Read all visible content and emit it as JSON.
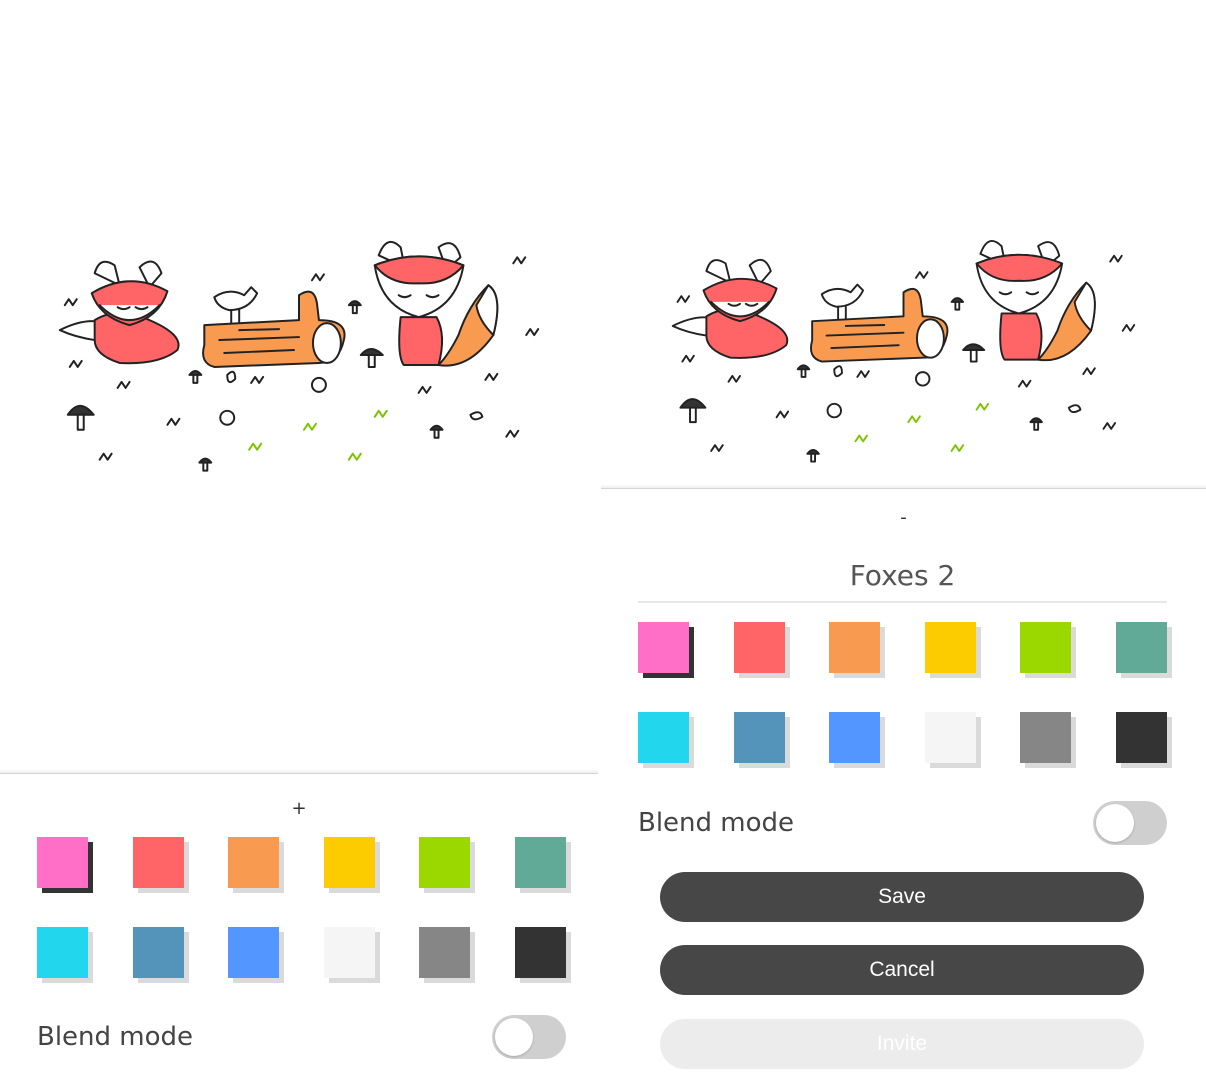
{
  "left_panel": {
    "handle": "+",
    "swatches": [
      {
        "color": "#ff6fc8",
        "selected": true
      },
      {
        "color": "#ff6466"
      },
      {
        "color": "#f89b50"
      },
      {
        "color": "#fccc00"
      },
      {
        "color": "#9ad800"
      },
      {
        "color": "#62aa98"
      },
      {
        "color": "#22d6ee"
      },
      {
        "color": "#5594ba"
      },
      {
        "color": "#5496ff"
      },
      {
        "color": "#f5f5f5"
      },
      {
        "color": "#868686"
      },
      {
        "color": "#333333"
      }
    ],
    "blend_mode_label": "Blend mode",
    "blend_mode_on": false
  },
  "right_panel": {
    "handle": "-",
    "name": "Foxes 2",
    "swatches": [
      {
        "color": "#ff6fc8",
        "selected": true
      },
      {
        "color": "#ff6466"
      },
      {
        "color": "#f89b50"
      },
      {
        "color": "#fccc00"
      },
      {
        "color": "#9ad800"
      },
      {
        "color": "#62aa98"
      },
      {
        "color": "#22d6ee"
      },
      {
        "color": "#5594ba"
      },
      {
        "color": "#5496ff"
      },
      {
        "color": "#f5f5f5"
      },
      {
        "color": "#868686"
      },
      {
        "color": "#333333"
      }
    ],
    "blend_mode_label": "Blend mode",
    "blend_mode_on": false,
    "buttons": {
      "save": "Save",
      "cancel": "Cancel",
      "invite": "Invite"
    }
  }
}
